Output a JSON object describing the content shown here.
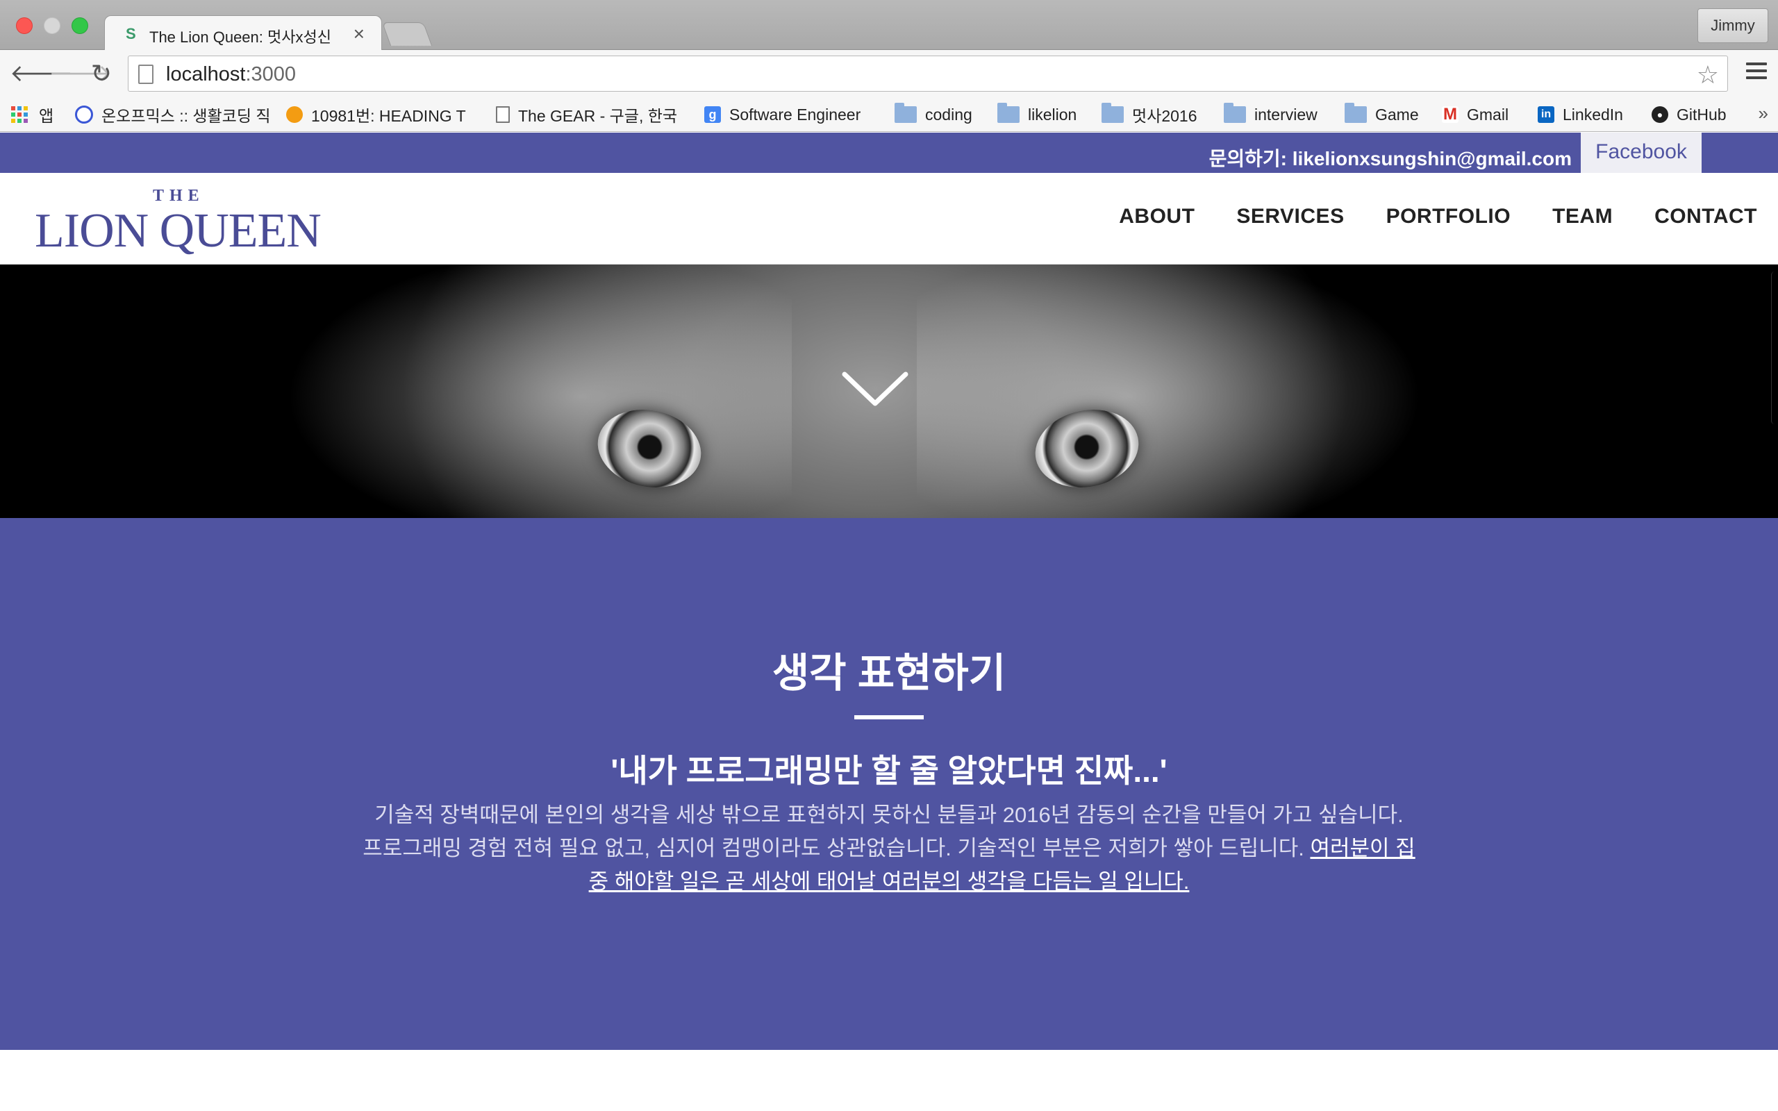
{
  "browser": {
    "tab_title": "The Lion Queen: 멋사x성신",
    "tab_favicon": "S",
    "tab_close": "×",
    "profile_name": "Jimmy",
    "url_host": "localhost",
    "url_port": ":3000",
    "bookmarks": [
      {
        "label": "앱",
        "icon": "apps-grid-icon"
      },
      {
        "label": "온오프믹스 :: 생활코딩 직",
        "icon": "onoffmix-icon"
      },
      {
        "label": "10981번: HEADING T",
        "icon": "boj-icon"
      },
      {
        "label": "The GEAR - 구글, 한국",
        "icon": "page-icon"
      },
      {
        "label": "Software Engineer",
        "icon": "google-icon"
      },
      {
        "label": "coding",
        "icon": "folder-icon"
      },
      {
        "label": "likelion",
        "icon": "folder-icon"
      },
      {
        "label": "멋사2016",
        "icon": "folder-icon"
      },
      {
        "label": "interview",
        "icon": "folder-icon"
      },
      {
        "label": "Game",
        "icon": "folder-icon"
      },
      {
        "label": "Gmail",
        "icon": "gmail-icon"
      },
      {
        "label": "LinkedIn",
        "icon": "linkedin-icon"
      },
      {
        "label": "GitHub",
        "icon": "github-icon"
      }
    ],
    "more_bookmarks": "»"
  },
  "site": {
    "topbar": {
      "contact_email": "문의하기: likelionxsungshin@gmail.com",
      "facebook_label": "Facebook"
    },
    "logo": {
      "the": "THE",
      "main": "LION QUEEN"
    },
    "nav": [
      "ABOUT",
      "SERVICES",
      "PORTFOLIO",
      "TEAM",
      "CONTACT"
    ],
    "about": {
      "title": "생각 표현하기",
      "tagline": "'내가 프로그래밍만 할 줄 알았다면 진짜...'",
      "desc_line1": "기술적 장벽때문에 본인의 생각을 세상 밖으로 표현하지 못하신 분들과 2016년 감동의 순간을 만들어 가고 싶습니다.",
      "desc_line2": "프로그래밍 경험 전혀 필요 없고, 심지어 컴맹이라도 상관없습니다. 기술적인 부분은 저희가 쌓아 드립니다. ",
      "desc_link": "여러분이 집중 해야할 일은 곧 세상에 태어날 여러분의 생각을 다듬는 일 입니다."
    }
  },
  "colors": {
    "brand": "#5054a1",
    "tabstrip": "#aaaaaa"
  }
}
